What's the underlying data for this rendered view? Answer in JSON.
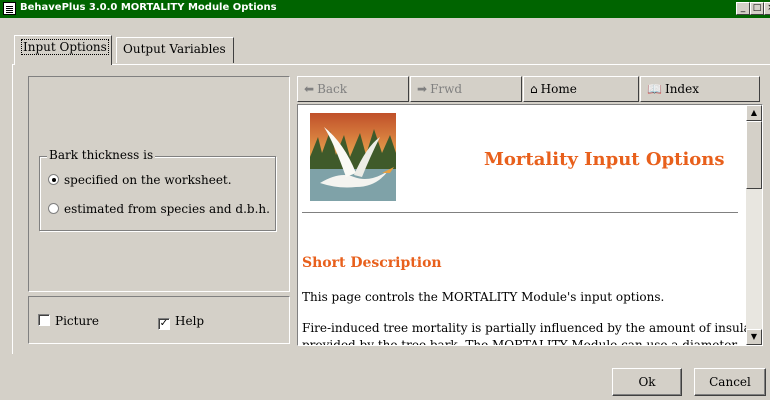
{
  "window": {
    "title": "BehavePlus 3.0.0 MORTALITY Module Options",
    "minimize": "_",
    "maximize": "□",
    "close": "×"
  },
  "tabs": [
    {
      "label": "Input Options",
      "active": true
    },
    {
      "label": "Output Variables",
      "active": false
    }
  ],
  "bark": {
    "legend": "Bark thickness is",
    "options": [
      {
        "label": "specified on the worksheet.",
        "checked": true
      },
      {
        "label": "estimated from species and d.b.h.",
        "checked": false
      }
    ]
  },
  "display": {
    "picture": {
      "label": "Picture",
      "checked": false
    },
    "help": {
      "label": "Help",
      "checked": true
    }
  },
  "browser_nav": {
    "back": {
      "label": "Back",
      "icon": "arrow-left-icon",
      "enabled": false
    },
    "forward": {
      "label": "Frwd",
      "icon": "arrow-right-icon",
      "enabled": false
    },
    "home": {
      "label": "Home",
      "icon": "home-icon",
      "enabled": true
    },
    "index": {
      "label": "Index",
      "icon": "book-icon",
      "enabled": true
    }
  },
  "help_page": {
    "heading": "Mortality Input Options",
    "section_heading": "Short Description",
    "paragraph_1": "This page controls the MORTALITY Module's input options.",
    "paragraph_2": "Fire-induced tree mortality is partially influenced by the amount of insulation",
    "paragraph_3": "provided by the tree bark. The MORTALITY Module can use a diameter",
    "accent_color": "#e8601c"
  },
  "buttons": {
    "ok": "Ok",
    "cancel": "Cancel"
  }
}
